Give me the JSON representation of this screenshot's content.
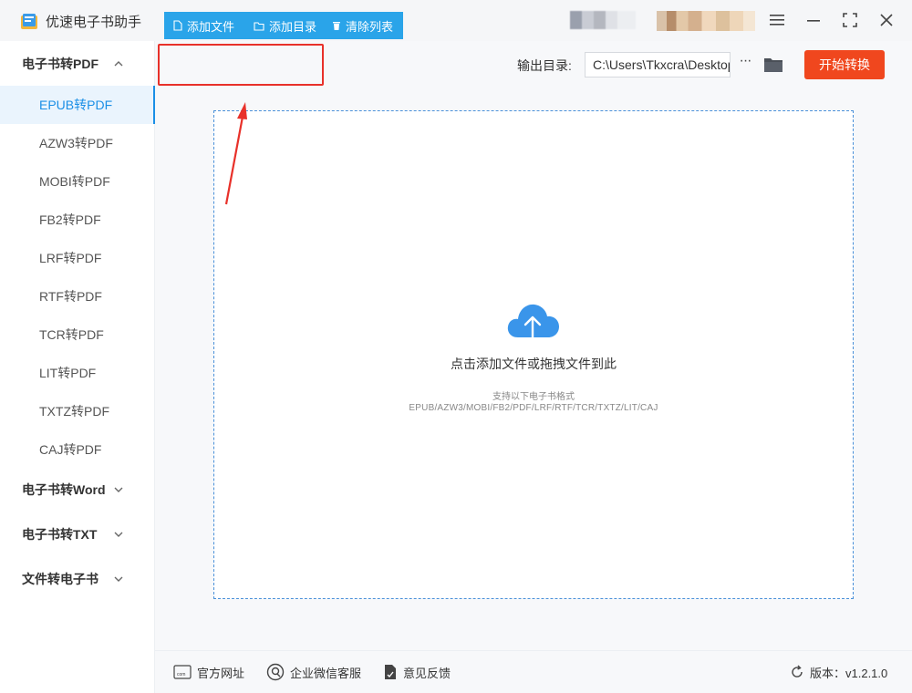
{
  "app": {
    "title": "优速电子书助手"
  },
  "window_controls": [
    "menu-icon",
    "minimize-icon",
    "maximize-icon",
    "close-icon"
  ],
  "sidebar": {
    "groups": [
      {
        "label": "电子书转PDF",
        "expanded": true,
        "items": [
          {
            "label": "EPUB转PDF",
            "active": true
          },
          {
            "label": "AZW3转PDF"
          },
          {
            "label": "MOBI转PDF"
          },
          {
            "label": "FB2转PDF"
          },
          {
            "label": "LRF转PDF"
          },
          {
            "label": "RTF转PDF"
          },
          {
            "label": "TCR转PDF"
          },
          {
            "label": "LIT转PDF"
          },
          {
            "label": "TXTZ转PDF"
          },
          {
            "label": "CAJ转PDF"
          }
        ]
      },
      {
        "label": "电子书转Word",
        "expanded": false
      },
      {
        "label": "电子书转TXT",
        "expanded": false
      },
      {
        "label": "文件转电子书",
        "expanded": false
      }
    ]
  },
  "toolbar": {
    "add_file": "添加文件",
    "add_folder": "添加目录",
    "clear_list": "清除列表",
    "output_label": "输出目录:",
    "output_path": "C:\\Users\\Tkxcra\\Desktop",
    "more": "···",
    "start": "开始转换"
  },
  "dropzone": {
    "main": "点击添加文件或拖拽文件到此",
    "sub": "支持以下电子书格式",
    "formats": "EPUB/AZW3/MOBI/FB2/PDF/LRF/RTF/TCR/TXTZ/LIT/CAJ"
  },
  "footer": {
    "website": "官方网址",
    "wechat": "企业微信客服",
    "feedback": "意见反馈",
    "version": "版本：v1.2.1.0"
  },
  "colors": {
    "accent_blue": "#2aa4e9",
    "active_blue": "#1b8fe6",
    "start_red": "#f0471e",
    "annotation_red": "#e8312a"
  }
}
